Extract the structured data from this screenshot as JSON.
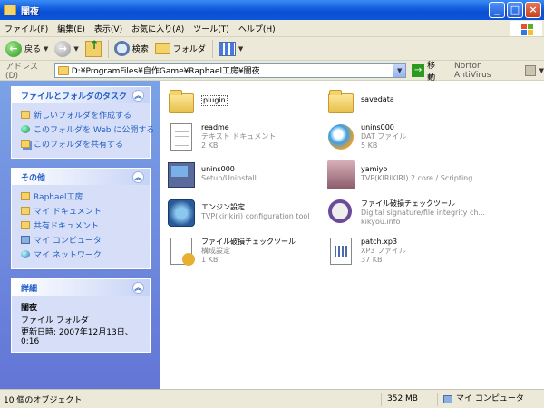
{
  "window": {
    "title": "闇夜"
  },
  "menu": [
    "ファイル(F)",
    "編集(E)",
    "表示(V)",
    "お気に入り(A)",
    "ツール(T)",
    "ヘルプ(H)"
  ],
  "toolbar": {
    "back": "戻る",
    "search": "検索",
    "folders": "フォルダ"
  },
  "address": {
    "label": "アドレス(D)",
    "path": "D:¥ProgramFiles¥自作Game¥Raphael工房¥闇夜",
    "go": "移動",
    "antivirus": "Norton AntiVirus"
  },
  "tasks": {
    "title": "ファイルとフォルダのタスク",
    "items": [
      "新しいフォルダを作成する",
      "このフォルダを Web に公開する",
      "このフォルダを共有する"
    ]
  },
  "other": {
    "title": "その他",
    "items": [
      "Raphael工房",
      "マイ ドキュメント",
      "共有ドキュメント",
      "マイ コンピュータ",
      "マイ ネットワーク"
    ]
  },
  "details": {
    "title": "詳細",
    "name": "闇夜",
    "type": "ファイル フォルダ",
    "modified": "更新日時: 2007年12月13日、0:16"
  },
  "files": [
    {
      "name": "plugin",
      "l1": "",
      "l2": ""
    },
    {
      "name": "savedata",
      "l1": "",
      "l2": ""
    },
    {
      "name": "readme",
      "l1": "テキスト ドキュメント",
      "l2": "2 KB"
    },
    {
      "name": "unins000",
      "l1": "DAT ファイル",
      "l2": "5 KB"
    },
    {
      "name": "unins000",
      "l1": "Setup/Uninstall",
      "l2": ""
    },
    {
      "name": "yamiyo",
      "l1": "TVP(KIRIKIRI) 2 core / Scripting ...",
      "l2": ""
    },
    {
      "name": "エンジン設定",
      "l1": "TVP(kirikiri) configuration tool",
      "l2": ""
    },
    {
      "name": "ファイル破損チェックツール",
      "l1": "Digital signature/file integrity ch...",
      "l2": "kikyou.info"
    },
    {
      "name": "ファイル破損チェックツール",
      "l1": "構成設定",
      "l2": "1 KB"
    },
    {
      "name": "patch.xp3",
      "l1": "XP3 ファイル",
      "l2": "37 KB"
    }
  ],
  "status": {
    "count": "10 個のオブジェクト",
    "size": "352 MB",
    "location": "マイ コンピュータ"
  }
}
